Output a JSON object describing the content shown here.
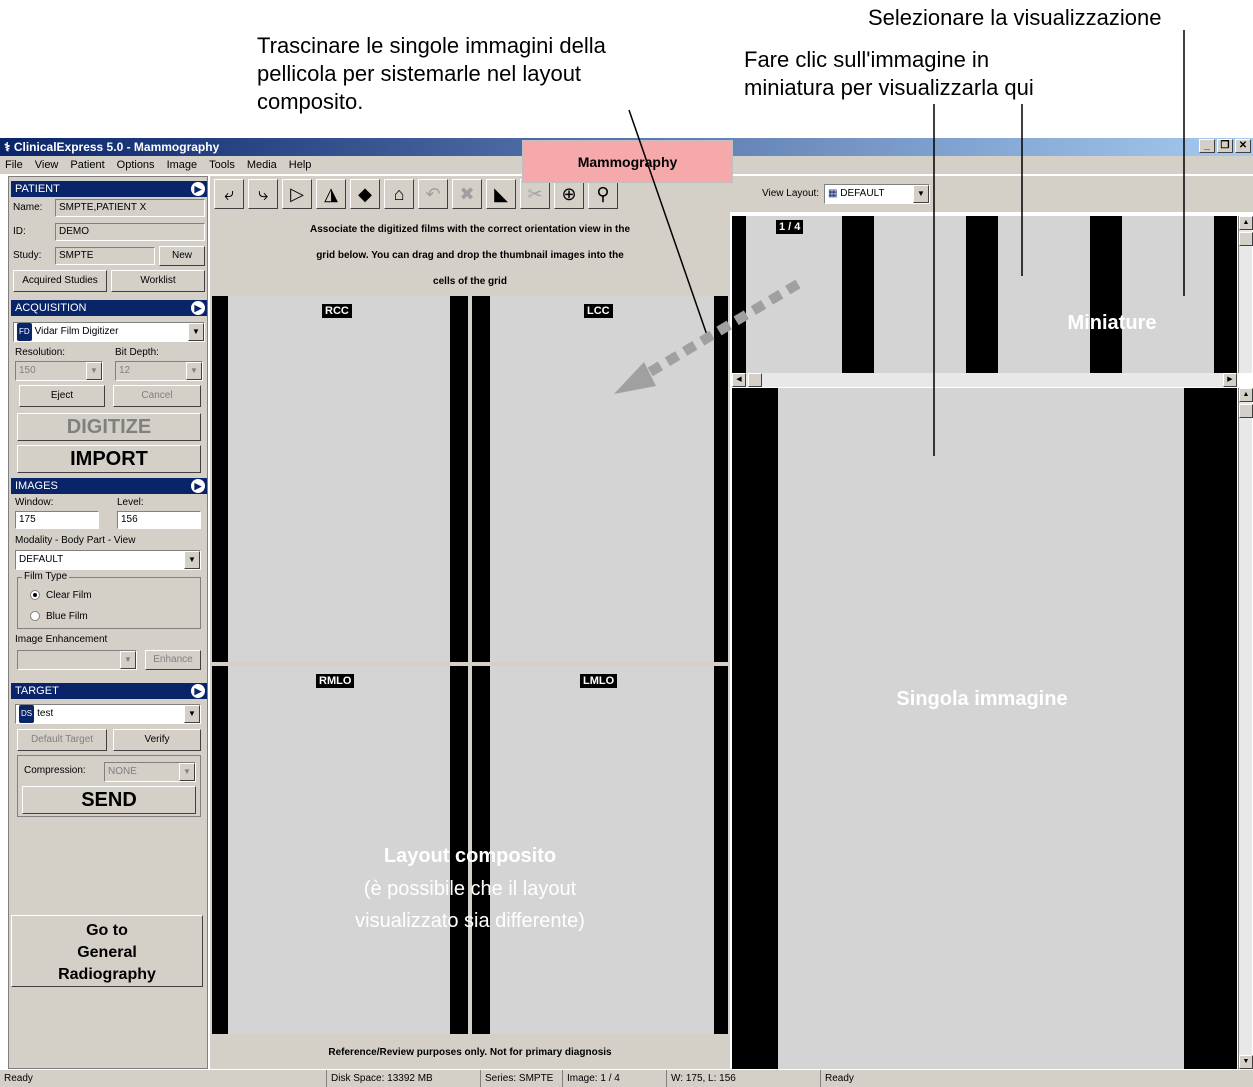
{
  "annotations": {
    "top_right": "Selezionare la visualizzazione",
    "thumb_note_line1": "Fare clic sull'immagine in",
    "thumb_note_line2": "miniatura per visualizzarla qui",
    "drag_note_line1": "Trascinare le singole immagini della",
    "drag_note_line2": "pellicola per sistemarle nel layout",
    "drag_note_line3": "composito.",
    "miniature": "Miniature",
    "single_image": "Singola immagine",
    "composite_title": "Layout composito",
    "composite_sub1": "(è possibile che il layout",
    "composite_sub2": "visualizzato sia differente)"
  },
  "window": {
    "title": "ClinicalExpress 5.0 - Mammography",
    "menu": [
      "File",
      "View",
      "Patient",
      "Options",
      "Image",
      "Tools",
      "Media",
      "Help"
    ],
    "mode_tab": "Mammography"
  },
  "patient": {
    "header": "PATIENT",
    "name_label": "Name:",
    "name_value": "SMPTE,PATIENT X",
    "id_label": "ID:",
    "id_value": "DEMO",
    "study_label": "Study:",
    "study_value": "SMPTE",
    "new_button": "New",
    "acquired_button": "Acquired Studies",
    "worklist_button": "Worklist"
  },
  "acquisition": {
    "header": "ACQUISITION",
    "device_badge": "FD",
    "device": "Vidar Film Digitizer",
    "resolution_label": "Resolution:",
    "resolution_value": "150",
    "bitdepth_label": "Bit Depth:",
    "bitdepth_value": "12",
    "eject_button": "Eject",
    "cancel_button": "Cancel",
    "digitize_button": "DIGITIZE",
    "import_button": "IMPORT"
  },
  "images": {
    "header": "IMAGES",
    "window_label": "Window:",
    "window_value": "175",
    "level_label": "Level:",
    "level_value": "156",
    "modality_label": "Modality - Body Part - View",
    "modality_value": "DEFAULT",
    "film_type_label": "Film Type",
    "clear_film": "Clear Film",
    "blue_film": "Blue Film",
    "enhancement_label": "Image Enhancement",
    "enhance_button": "Enhance"
  },
  "target": {
    "header": "TARGET",
    "badge": "DS",
    "value": "test",
    "default_target_button": "Default Target",
    "verify_button": "Verify",
    "compression_label": "Compression:",
    "compression_value": "NONE",
    "send_button": "SEND"
  },
  "goto_button": {
    "line1": "Go to",
    "line2": "General",
    "line3": "Radiography"
  },
  "toolbar": {
    "view_layout_label": "View Layout:",
    "view_layout_value": "DEFAULT"
  },
  "composite": {
    "instruction1": "Associate the digitized films with the correct orientation view in the",
    "instruction2": "grid below.  You can drag and drop the thumbnail images into the",
    "instruction3": "cells of the grid",
    "cells": [
      "RCC",
      "LCC",
      "RMLO",
      "LMLO"
    ],
    "footer": "Reference/Review purposes only. Not for primary diagnosis"
  },
  "thumbnails": {
    "counter": "1 / 4"
  },
  "status": {
    "left": "Ready",
    "disk": "Disk Space: 13392 MB",
    "series": "Series: SMPTE",
    "image": "Image: 1 / 4",
    "wl": "W: 175, L: 156",
    "right": "Ready"
  }
}
